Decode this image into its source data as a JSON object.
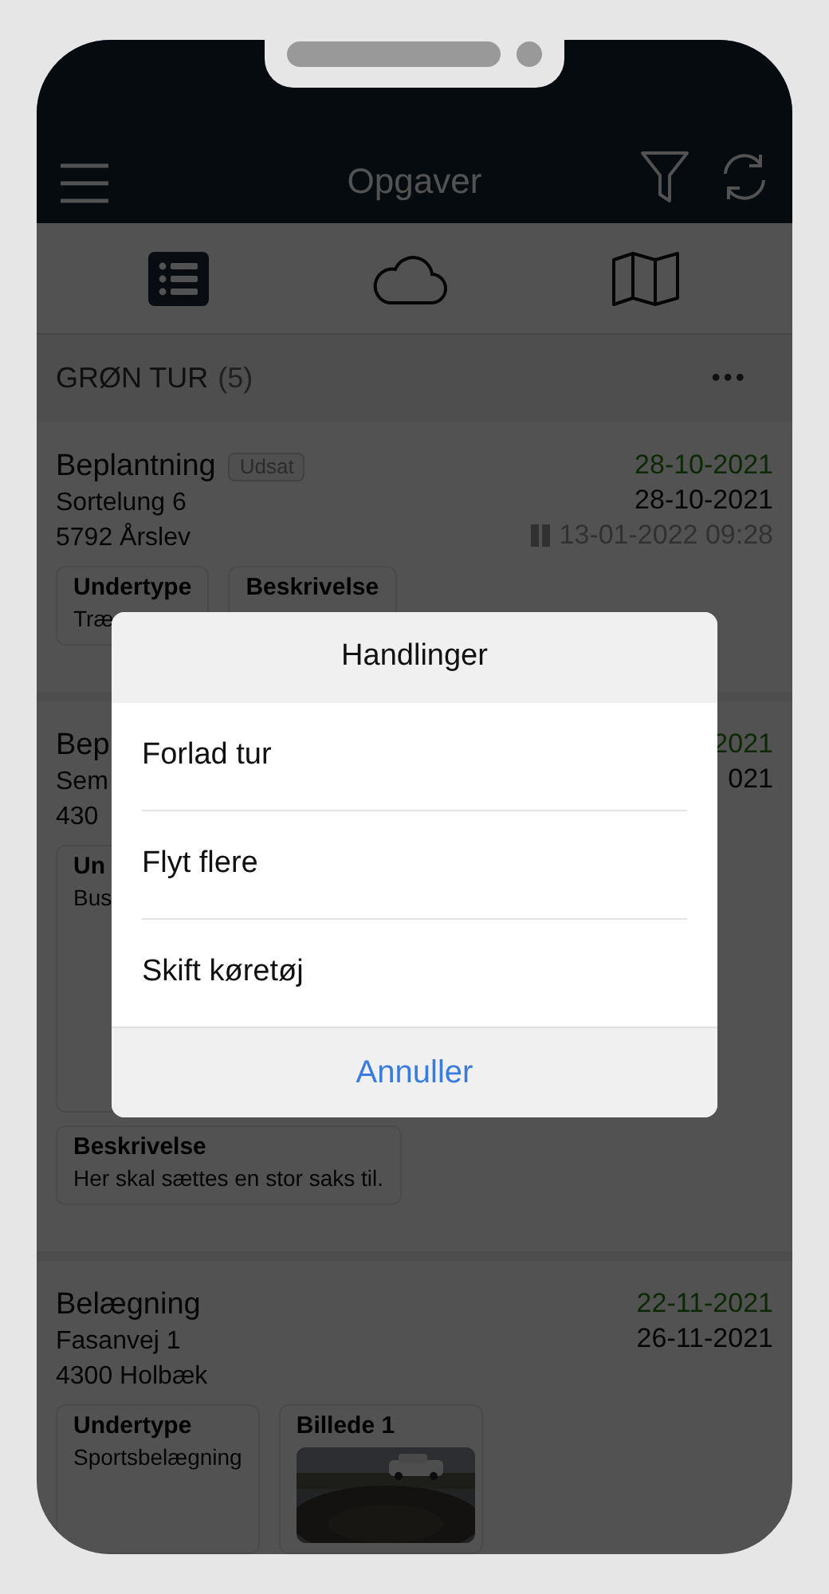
{
  "header": {
    "title": "Opgaver"
  },
  "tabs": [
    {
      "kind": "list",
      "selected": true
    },
    {
      "kind": "cloud",
      "selected": false
    },
    {
      "kind": "map",
      "selected": false
    }
  ],
  "section": {
    "title": "GRØN TUR",
    "count": "(5)",
    "more": "•••"
  },
  "tasks": [
    {
      "title": "Beplantning",
      "badge": "Udsat",
      "address": "Sortelung 6",
      "city": "5792 Årslev",
      "date_start": "28-10-2021",
      "date_end": "28-10-2021",
      "paused": true,
      "paused_at": "13-01-2022 09:28",
      "field_rows": [
        [
          {
            "kind": "text",
            "label": "Undertype",
            "value": "Træ"
          },
          {
            "kind": "text",
            "label": "Beskrivelse"
          }
        ]
      ]
    },
    {
      "title": "Bep",
      "address": "Sem",
      "city": "430",
      "date_start": "2021",
      "date_end": "021",
      "field_rows": [
        [
          {
            "kind": "text",
            "label": "Un",
            "value": "Bus"
          }
        ],
        [
          {
            "kind": "text",
            "label": "Beskrivelse",
            "value": "Her skal sættes en stor saks til."
          }
        ]
      ]
    },
    {
      "title": "Belægning",
      "address": "Fasanvej 1",
      "city": "4300 Holbæk",
      "date_start": "22-11-2021",
      "date_end": "26-11-2021",
      "field_rows": [
        [
          {
            "kind": "text",
            "label": "Undertype",
            "value": "Sportsbelægning"
          },
          {
            "label": "Billede 1"
          }
        ]
      ]
    }
  ],
  "dialog": {
    "title": "Handlinger",
    "actions": [
      "Forlad tur",
      "Flyt flere",
      "Skift køretøj"
    ],
    "cancel": "Annuller"
  }
}
